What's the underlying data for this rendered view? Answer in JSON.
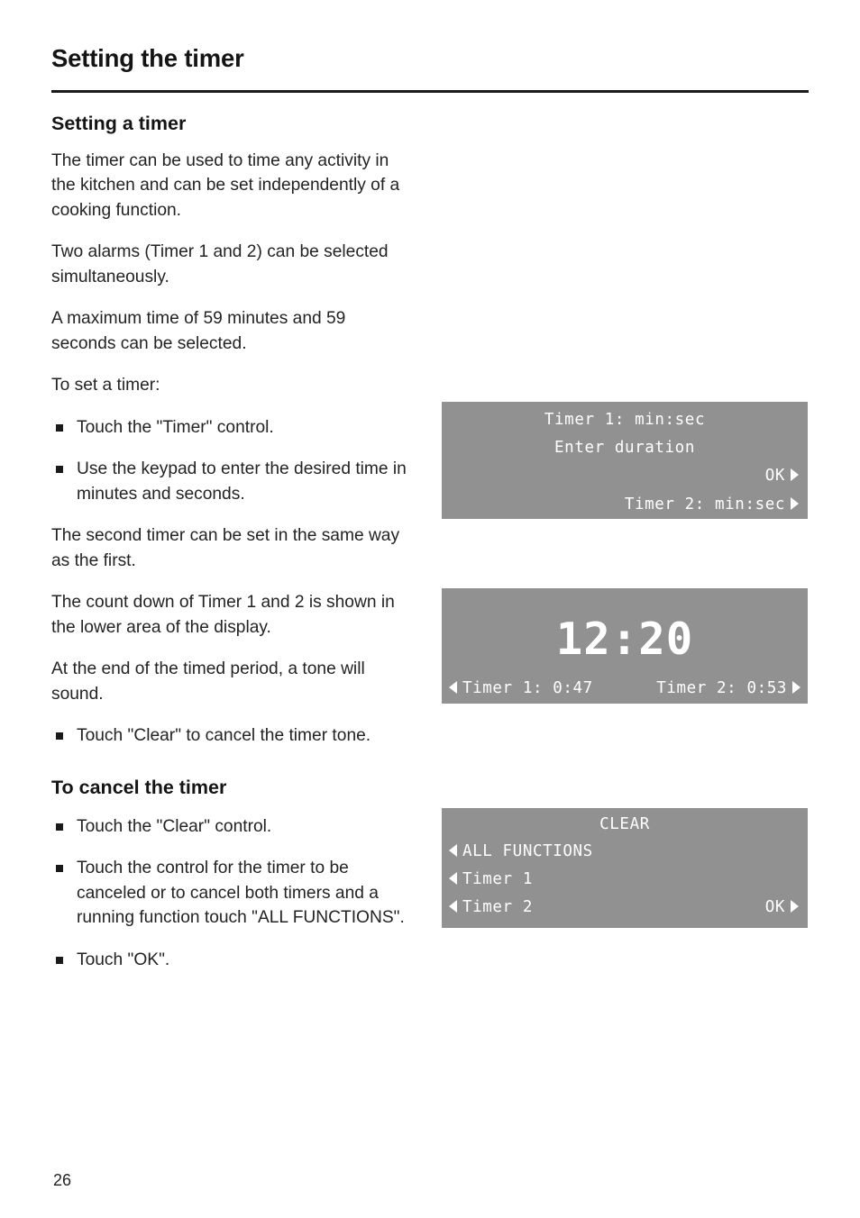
{
  "header": {
    "title": "Setting the timer"
  },
  "sections": {
    "setting_a_timer": {
      "heading": "Setting a timer",
      "paragraphs": [
        "The timer can be used to time any activity in the kitchen and can be set independently of a cooking function.",
        "Two alarms (Timer 1 and 2) can be selected simultaneously.",
        "A maximum time of 59 minutes and 59 seconds can be selected.",
        "To set a timer:"
      ],
      "bullets_first": [
        "Touch the \"Timer\" control.",
        "Use the keypad to enter the desired time in minutes and seconds."
      ],
      "paragraphs_mid": [
        "The second timer can be set in the same way as the first.",
        "The count down of Timer 1 and 2 is shown in the lower area of the display.",
        "At the end of the timed period, a tone will sound."
      ],
      "bullets_second": [
        "Touch \"Clear\" to cancel the timer tone."
      ]
    },
    "to_cancel_the_timer": {
      "heading": "To cancel the timer",
      "bullets": [
        "Touch the \"Clear\" control.",
        "Touch the control for the timer to be canceled or to cancel both timers and a running function touch \"ALL FUNCTIONS\".",
        "Touch \"OK\"."
      ]
    }
  },
  "displays": {
    "timer_entry": {
      "line1": "Timer 1: min:sec",
      "line2": "Enter duration",
      "ok_label": "OK",
      "strip_label": "Timer 2: min:sec",
      "arrow_right_icon": "arrow-right-icon"
    },
    "clock": {
      "time": "12:20",
      "timer1_label": "Timer 1: 0:47",
      "timer2_label": "Timer 2: 0:53",
      "arrow_left_icon": "arrow-left-icon",
      "arrow_right_icon": "arrow-right-icon"
    },
    "clear_menu": {
      "title": "CLEAR",
      "items": [
        "ALL FUNCTIONS",
        "Timer 1",
        "Timer 2"
      ],
      "ok_label": "OK"
    }
  },
  "footer": {
    "page_number": "26"
  },
  "colors": {
    "lcd_background": "#919191",
    "lcd_text": "#ffffff",
    "page_background": "#ffffff",
    "body_text": "#232323"
  }
}
